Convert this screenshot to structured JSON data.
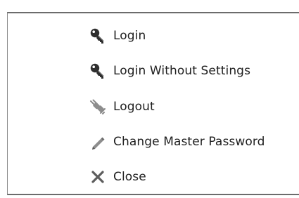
{
  "menu": {
    "items": [
      {
        "label": "Login",
        "icon": "key-icon"
      },
      {
        "label": "Login Without Settings",
        "icon": "key-icon"
      },
      {
        "label": "Logout",
        "icon": "unplug-icon"
      },
      {
        "label": "Change Master Password",
        "icon": "pencil-icon"
      },
      {
        "label": "Close",
        "icon": "close-icon"
      }
    ]
  },
  "colors": {
    "text": "#1f1f1f",
    "border": "#6c6c6c",
    "icon_dark": "#3a3a3a",
    "icon_gray": "#8d8d8d"
  }
}
